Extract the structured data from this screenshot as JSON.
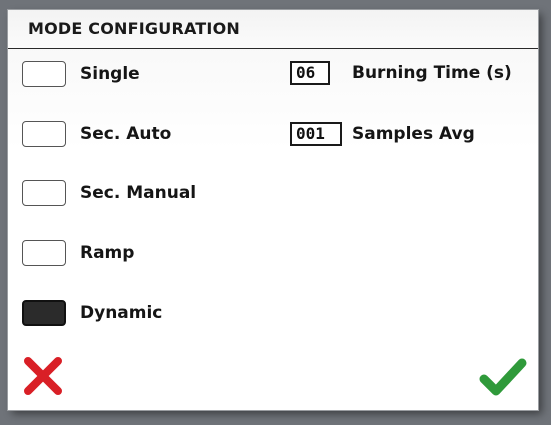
{
  "header": {
    "title": "MODE CONFIGURATION"
  },
  "modes": [
    {
      "label": "Single",
      "checked": false
    },
    {
      "label": "Sec. Auto",
      "checked": false
    },
    {
      "label": "Sec. Manual",
      "checked": false
    },
    {
      "label": "Ramp",
      "checked": false
    },
    {
      "label": "Dynamic",
      "checked": true
    }
  ],
  "params": {
    "burning_time": {
      "value": "06",
      "label": "Burning Time (s)"
    },
    "samples_avg": {
      "value": "001",
      "label": "Samples Avg"
    }
  },
  "actions": {
    "cancel_icon": "close-x-icon",
    "confirm_icon": "checkmark-icon",
    "cancel_color": "#d91f26",
    "confirm_color": "#2f9a3a"
  },
  "colors": {
    "checked_fill": "#2b2b2b",
    "unchecked_fill": "#ffffff"
  }
}
